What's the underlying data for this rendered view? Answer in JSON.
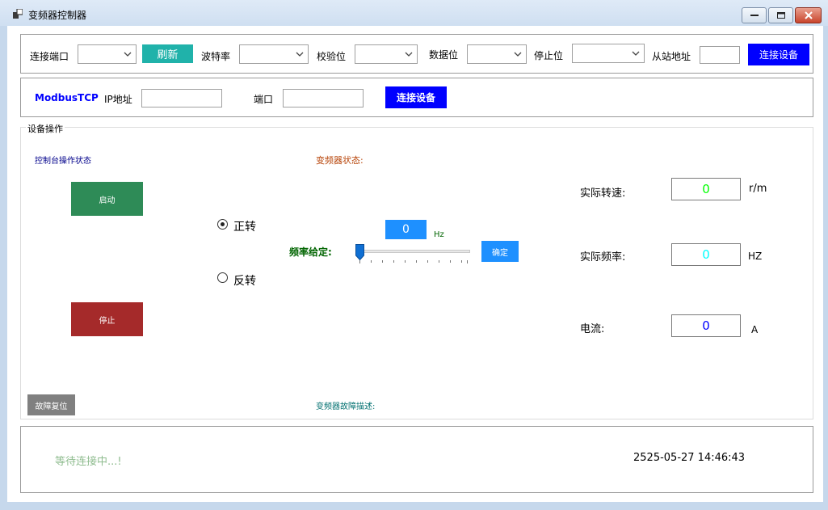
{
  "window": {
    "title": "变频器控制器",
    "buttons": [
      "minimize",
      "maximize",
      "close"
    ]
  },
  "serial": {
    "port_label": "连接端口",
    "port_value": "",
    "refresh_label": "刷新",
    "baud_label": "波特率",
    "baud_value": "",
    "parity_label": "校验位",
    "parity_value": "",
    "databits_label": "数据位",
    "databits_value": "",
    "stopbits_label": "停止位",
    "stopbits_value": "",
    "slave_label": "从站地址",
    "slave_value": "",
    "connect_label": "连接设备"
  },
  "tcp": {
    "title": "ModbusTCP",
    "ip_label": "IP地址",
    "ip_value": "",
    "port_label": "端口",
    "port_value": "",
    "connect_label": "连接设备"
  },
  "device": {
    "group_title": "设备操作",
    "console_status_label": "控制台操作状态",
    "start_label": "启动",
    "stop_label": "停止",
    "forward_label": "正转",
    "reverse_label": "反转",
    "direction_selected": "正转",
    "inverter_status_label": "变频器状态:",
    "freq_setting_label": "频率给定:",
    "freq_value": "0",
    "freq_unit": "Hz",
    "slider_value_fraction": 0,
    "confirm_label": "确定",
    "fault_reset_label": "故障复位",
    "fault_desc_label": "变频器故障描述:"
  },
  "readings": {
    "speed_label": "实际转速:",
    "speed_value": "0",
    "speed_unit": "r/m",
    "freq_label": "实际频率:",
    "freq_value": "0",
    "freq_unit": "HZ",
    "current_label": "电流:",
    "current_value": "0",
    "current_unit": "A"
  },
  "status": {
    "message": "等待连接中...!",
    "datetime": "2525-05-27 14:46:43"
  },
  "colors": {
    "refresh_btn": "#20b2aa",
    "connect_btn": "#0000ff",
    "start_btn": "#2e8b57",
    "stop_btn": "#a52a2a",
    "confirm_btn": "#1e90ff",
    "freq_box": "#1e90ff",
    "fault_btn": "#808080",
    "speed_text": "#00ff00",
    "freq_text": "#00ffff",
    "current_text": "#0000ff"
  }
}
